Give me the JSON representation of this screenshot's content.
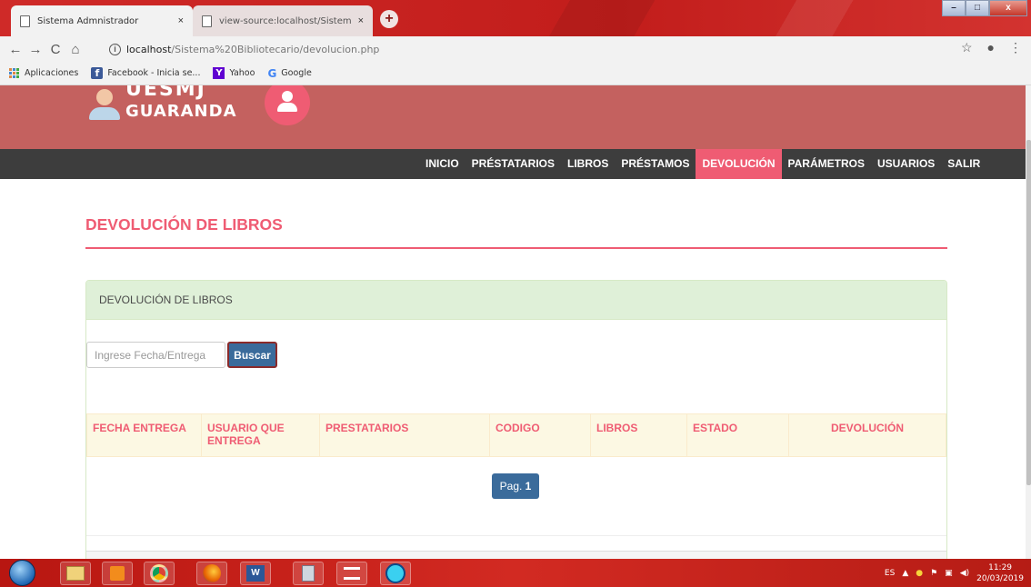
{
  "browser": {
    "tabs": [
      {
        "title": "Sistema Admnistrador",
        "active": true
      },
      {
        "title": "view-source:localhost/Sistema Bi",
        "active": false
      }
    ],
    "new_tab_label": "+",
    "tab_close": "×",
    "url_host": "localhost",
    "url_path": "/Sistema%20Bibliotecario/devolucion.php",
    "bookmarks": [
      {
        "label": "Aplicaciones",
        "icon": "apps-grid-icon"
      },
      {
        "label": "Facebook - Inicia se...",
        "icon": "facebook-icon"
      },
      {
        "label": "Yahoo",
        "icon": "yahoo-icon"
      },
      {
        "label": "Google",
        "icon": "google-icon"
      }
    ]
  },
  "site": {
    "logo_top": "UESMJ",
    "logo_name": "GUARANDA",
    "nav": [
      "INICIO",
      "PRÉSTATARIOS",
      "LIBROS",
      "PRÉSTAMOS",
      "DEVOLUCIÓN",
      "PARÁMETROS",
      "USUARIOS",
      "SALIR"
    ],
    "active_nav": "DEVOLUCIÓN"
  },
  "page": {
    "title": "DEVOLUCIÓN DE LIBROS",
    "panel_heading": "DEVOLUCIÓN DE LIBROS",
    "search_placeholder": "Ingrese Fecha/Entrega",
    "search_button": "Buscar",
    "columns": [
      "FECHA ENTREGA",
      "USUARIO QUE ENTREGA",
      "PRESTATARIOS",
      "CODIGO",
      "LIBROS",
      "ESTADO",
      "DEVOLUCIÓN"
    ],
    "pager_label": "Pag.",
    "pager_number": "1"
  },
  "taskbar": {
    "language": "ES",
    "time": "11:29",
    "date": "20/03/2019"
  },
  "colors": {
    "accent": "#ef5c73",
    "header": "#c4615f",
    "navbar": "#3d3d3d",
    "button": "#3a6b9b"
  }
}
